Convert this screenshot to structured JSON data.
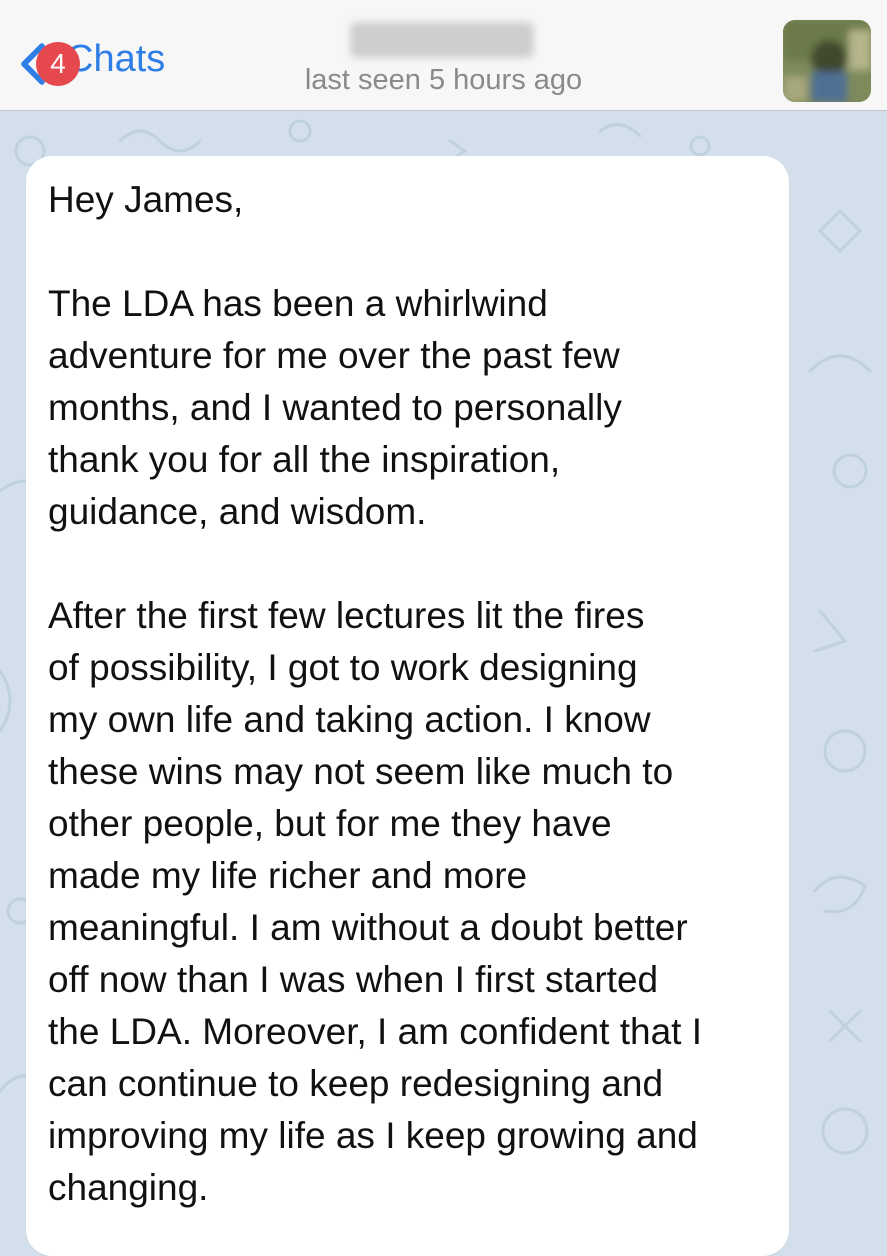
{
  "header": {
    "back_label": "Chats",
    "unread_count": "4",
    "status": "last seen 5 hours ago"
  },
  "colors": {
    "accent": "#2f7ee6",
    "badge": "#e5484d",
    "wallpaper": "#d3e0eb",
    "bubble": "#ffffff"
  },
  "message": {
    "greeting": "Hey James,",
    "paragraph_1": "The LDA has been a whirlwind\nadventure for me over the past few\nmonths, and I wanted to personally\nthank you for all the inspiration,\nguidance, and wisdom.",
    "paragraph_2": "After the first few lectures lit the fires\nof possibility, I got to work designing\nmy own life and taking action. I know\nthese wins may not seem like much to\nother people, but for me they have\nmade my life richer and more\nmeaningful. I am without a doubt better\noff now than I was when I first started\nthe LDA. Moreover, I am confident that I\ncan continue to keep redesigning and\nimproving my life as I keep growing and\nchanging."
  }
}
